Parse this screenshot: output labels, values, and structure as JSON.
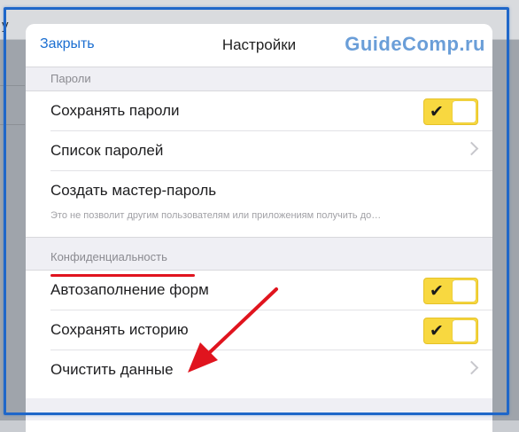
{
  "background": {
    "letter": "у"
  },
  "nav": {
    "close_label": "Закрыть",
    "title": "Настройки",
    "watermark": "GuideComp.ru"
  },
  "sections": {
    "passwords": {
      "header": "Пароли",
      "rows": [
        {
          "label": "Сохранять пароли",
          "control": "toggle",
          "on": true
        },
        {
          "label": "Список паролей",
          "control": "chevron"
        },
        {
          "label": "Создать мастер-пароль",
          "subtitle": "Это не позволит другим пользователям или приложениям получить до…"
        }
      ]
    },
    "privacy": {
      "header": "Конфиденциальность",
      "rows": [
        {
          "label": "Автозаполнение форм",
          "control": "toggle",
          "on": true
        },
        {
          "label": "Сохранять историю",
          "control": "toggle",
          "on": true
        },
        {
          "label": "Очистить данные",
          "control": "chevron"
        }
      ]
    }
  },
  "colors": {
    "accent": "#f8d840",
    "link": "#1c6fd1",
    "annotation": "#e0141e",
    "frame": "#1f67c9"
  }
}
